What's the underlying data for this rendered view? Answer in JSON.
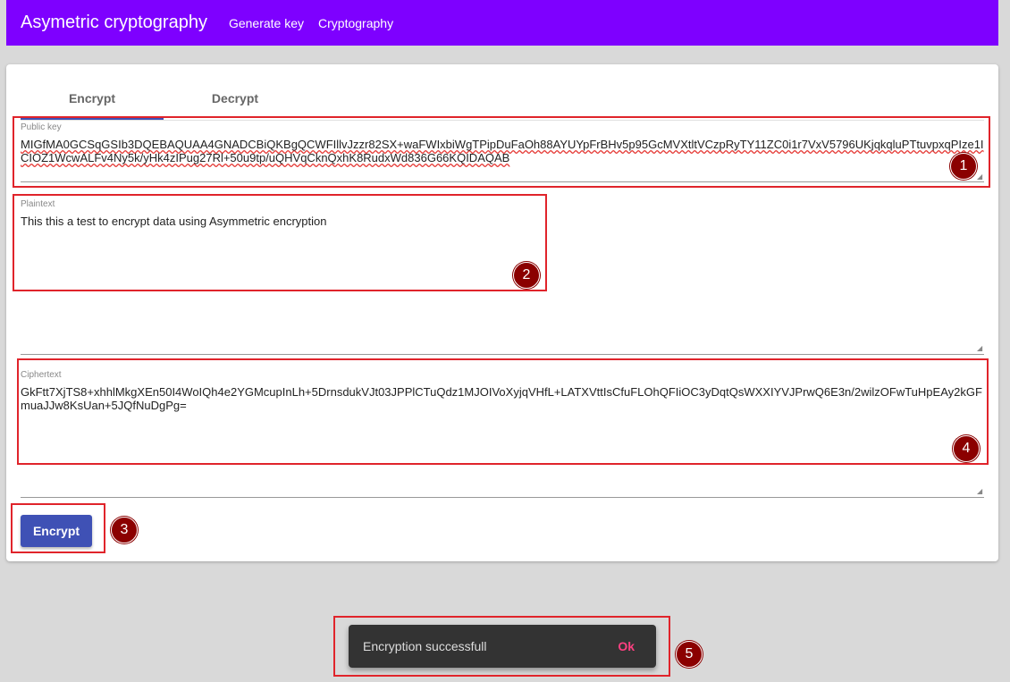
{
  "toolbar": {
    "title": "Asymetric cryptography",
    "nav": [
      "Generate key",
      "Cryptography"
    ],
    "color": "#7e00ff"
  },
  "tabs": [
    {
      "label": "Encrypt",
      "active": true
    },
    {
      "label": "Decrypt",
      "active": false
    }
  ],
  "form": {
    "public_key": {
      "label": "Public key",
      "value": "MIGfMA0GCSqGSIb3DQEBAQUAA4GNADCBiQKBgQCWFIllvJzzr82SX+waFWIxbiWgTPipDuFaOh88AYUYpFrBHv5p95GcMVXtltVCzpRyTY11ZC0i1r7VxV5796UKjqkqluPTtuvpxqPIze1ICIOZ1WcwALFv4Ny5k/yHk4zIPug27Rl+50u9tp/uQHVqCknQxhK8RudxWd836G66KQIDAQAB"
    },
    "plaintext": {
      "label": "Plaintext",
      "value": "This this a test to encrypt data using Asymmetric encryption"
    },
    "ciphertext": {
      "label": "Ciphertext",
      "value": "GkFtt7XjTS8+xhhlMkgXEn50I4WoIQh4e2YGMcupInLh+5DrnsdukVJt03JPPlCTuQdz1MJOIVoXyjqVHfL+LATXVttIsCfuFLOhQFIiOC3yDqtQsWXXIYVJPrwQ6E3n/2wilzOFwTuHpEAy2kGFmuaJJw8KsUan+5JQfNuDgPg="
    },
    "encrypt_button": "Encrypt"
  },
  "snackbar": {
    "message": "Encryption successfull",
    "action": "Ok"
  },
  "annotations": [
    "1",
    "2",
    "3",
    "4",
    "5"
  ],
  "colors": {
    "primary": "#3f51b5",
    "annotation": "#e0242b",
    "badge": "#8b0000",
    "snack_action": "#ff4081"
  }
}
